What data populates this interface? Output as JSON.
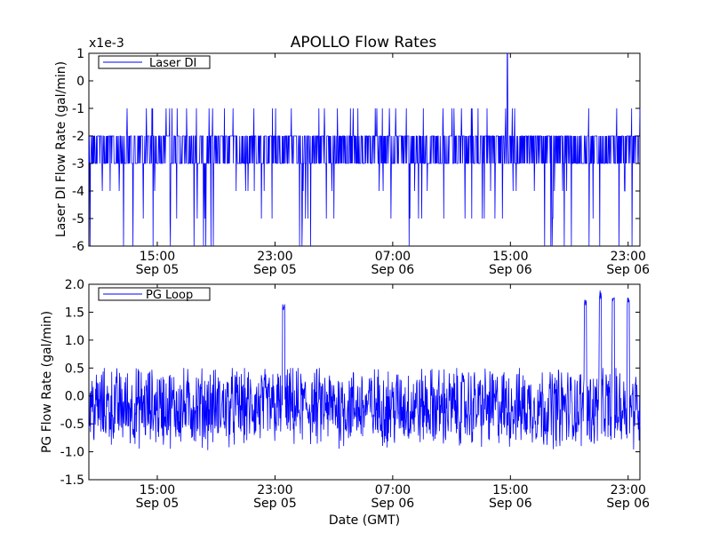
{
  "chart_data": [
    {
      "type": "line",
      "title": "APOLLO Flow Rates",
      "scale_note": "x1e-3",
      "ylabel": "Laser DI Flow Rate (gal/min)",
      "xlabel": "",
      "ylim": [
        -6,
        1
      ],
      "yticks": [
        "1",
        "0",
        "-1",
        "-2",
        "-3",
        "-4",
        "-5",
        "-6"
      ],
      "ytick_values": [
        1,
        0,
        -1,
        -2,
        -3,
        -4,
        -5,
        -6
      ],
      "x_range_hours": [
        10.35,
        47.8
      ],
      "xticks": [
        {
          "hour": 15,
          "time": "15:00",
          "date": "Sep 05"
        },
        {
          "hour": 23,
          "time": "23:00",
          "date": "Sep 05"
        },
        {
          "hour": 31,
          "time": "07:00",
          "date": "Sep 06"
        },
        {
          "hour": 39,
          "time": "15:00",
          "date": "Sep 06"
        },
        {
          "hour": 47,
          "time": "23:00",
          "date": "Sep 06"
        }
      ],
      "legend": "top-left",
      "grid": false,
      "color": "#0000ff",
      "series": [
        {
          "name": "Laser DI",
          "baseline": -2.5,
          "band": [
            -3,
            -2
          ],
          "min": -6,
          "max": 1,
          "spike_at_hour": 38.8
        }
      ]
    },
    {
      "type": "line",
      "title": "",
      "ylabel": "PG Flow Rate (gal/min)",
      "xlabel": "Date (GMT)",
      "ylim": [
        -1.5,
        2.0
      ],
      "yticks": [
        "2.0",
        "1.5",
        "1.0",
        "0.5",
        "0.0",
        "-0.5",
        "-1.0",
        "-1.5"
      ],
      "ytick_values": [
        2.0,
        1.5,
        1.0,
        0.5,
        0.0,
        -0.5,
        -1.0,
        -1.5
      ],
      "x_range_hours": [
        10.35,
        47.8
      ],
      "xticks": [
        {
          "hour": 15,
          "time": "15:00",
          "date": "Sep 05"
        },
        {
          "hour": 23,
          "time": "23:00",
          "date": "Sep 05"
        },
        {
          "hour": 31,
          "time": "07:00",
          "date": "Sep 06"
        },
        {
          "hour": 39,
          "time": "15:00",
          "date": "Sep 06"
        },
        {
          "hour": 47,
          "time": "23:00",
          "date": "Sep 06"
        }
      ],
      "legend": "top-left",
      "grid": false,
      "color": "#0000ff",
      "series": [
        {
          "name": "PG Loop",
          "center": -0.2,
          "min": -1.0,
          "max": 0.5,
          "spikes": [
            {
              "hour": 23.6,
              "value": 1.7
            },
            {
              "hour": 44.1,
              "value": 1.8
            },
            {
              "hour": 45.1,
              "value": 1.9
            },
            {
              "hour": 46.0,
              "value": 1.85
            },
            {
              "hour": 47.0,
              "value": 1.8
            }
          ]
        }
      ]
    }
  ]
}
